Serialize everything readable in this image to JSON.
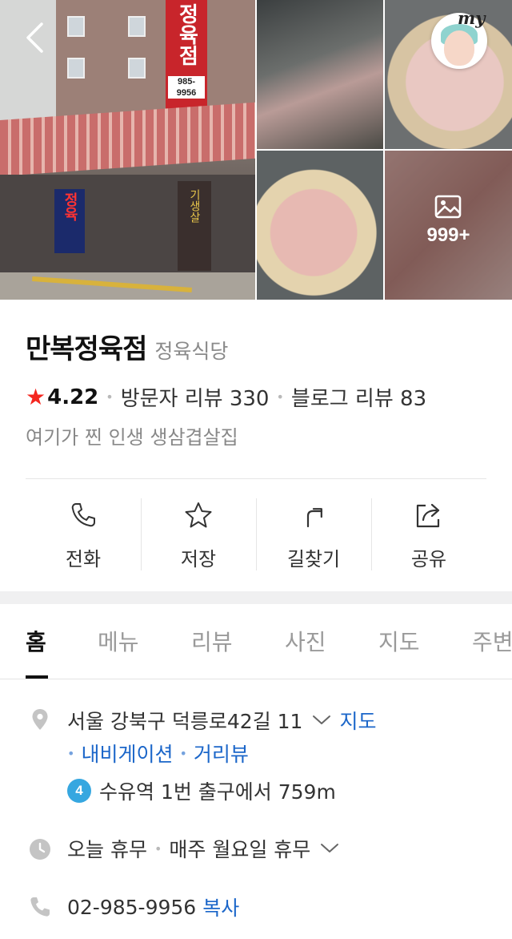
{
  "header": {
    "back_icon": "chevron-left-icon",
    "profile_badge": "my",
    "photo_count": "999+",
    "photo_icon": "image-icon",
    "storefront_sign": "정육점",
    "storefront_phone": "985-9956",
    "shop_sign_left": "정육",
    "shop_sign_right": "기생살"
  },
  "place": {
    "name": "만복정육점",
    "category": "정육식당",
    "rating": "4.22",
    "visitor_reviews": "방문자 리뷰 330",
    "blog_reviews": "블로그 리뷰 83",
    "description": "여기가 찐 인생 생삼겹살집"
  },
  "actions": [
    {
      "label": "전화",
      "icon": "phone-icon"
    },
    {
      "label": "저장",
      "icon": "star-outline-icon"
    },
    {
      "label": "길찾기",
      "icon": "directions-icon"
    },
    {
      "label": "공유",
      "icon": "share-icon"
    }
  ],
  "tabs": [
    {
      "label": "홈",
      "active": true
    },
    {
      "label": "메뉴"
    },
    {
      "label": "리뷰"
    },
    {
      "label": "사진"
    },
    {
      "label": "지도"
    },
    {
      "label": "주변"
    }
  ],
  "info": {
    "address": "서울 강북구 덕릉로42길 11",
    "map_link": "지도",
    "navigation_link": "내비게이션",
    "streetview_link": "거리뷰",
    "subway_line": "4",
    "subway_text": "수유역 1번 출구에서 759m",
    "hours_status": "오늘 휴무",
    "hours_detail": "매주 월요일 휴무",
    "phone": "02-985-9956",
    "copy_label": "복사"
  },
  "colors": {
    "accent_link": "#1b66c9",
    "star": "#f4261f",
    "subway_line_4": "#36a7e0"
  }
}
